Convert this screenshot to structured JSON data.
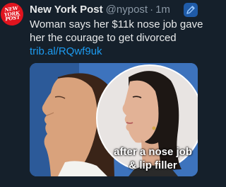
{
  "account": {
    "name": "New York Post",
    "handle": "@nypost",
    "separator": "·",
    "time": "1m",
    "avatar_text": [
      "NEW",
      "YORK",
      "POST"
    ]
  },
  "tweet": {
    "text": "Woman says her $11k nose job gave her the courage to get divorced",
    "link": "trib.al/RQwf9uk"
  },
  "media": {
    "caption_line1": "after a nose job",
    "caption_line2": "& lip filler"
  },
  "colors": {
    "background": "#15202b",
    "text": "#e7e9ea",
    "muted": "#8b98a5",
    "link": "#1d9bf0",
    "brand": "#e0141e"
  },
  "icons": {
    "app": "pen-icon"
  }
}
